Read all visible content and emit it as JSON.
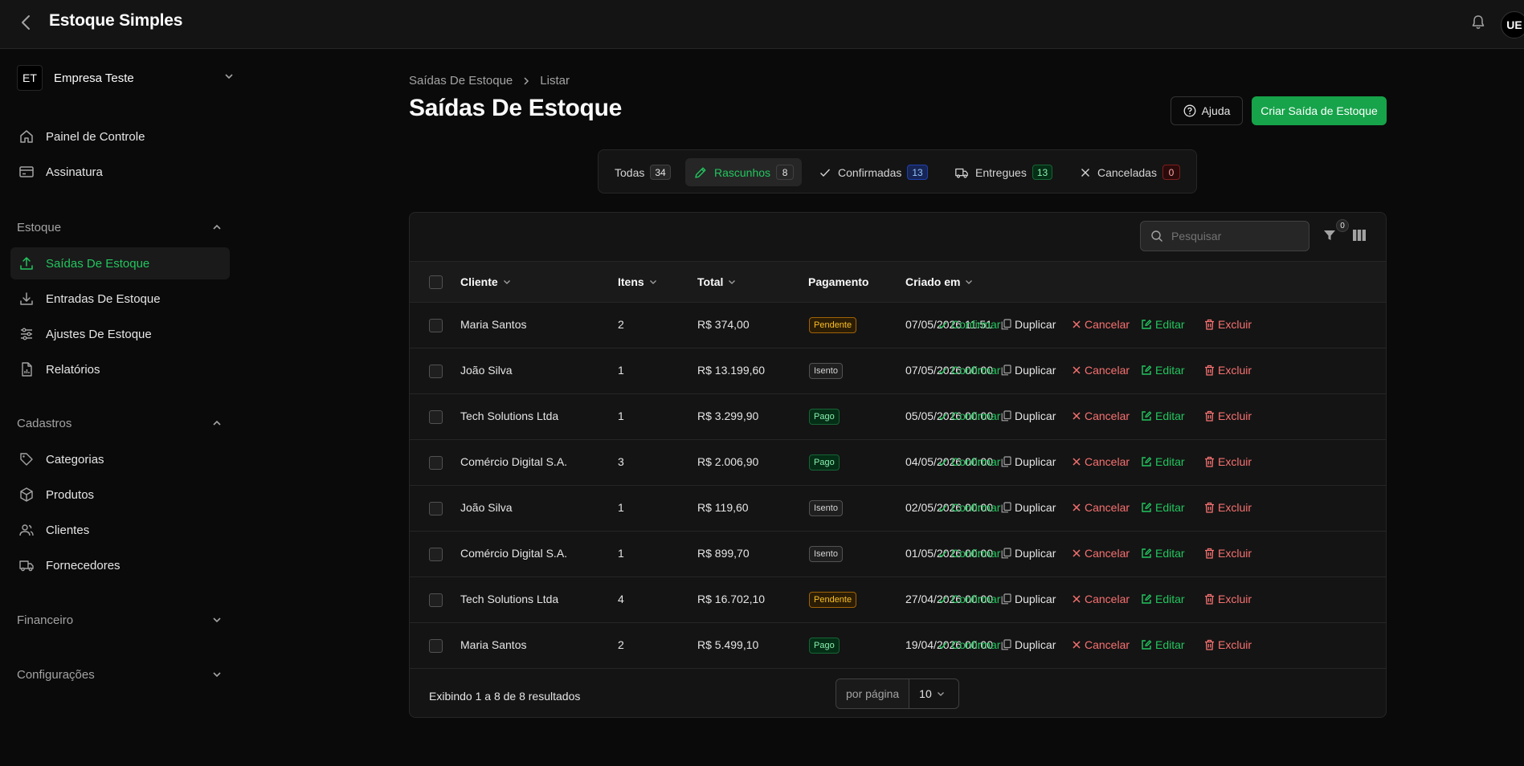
{
  "app": {
    "title": "Estoque Simples",
    "avatar": "UE"
  },
  "sidebar": {
    "company": {
      "initials": "ET",
      "name": "Empresa Teste"
    },
    "top_items": [
      {
        "label": "Painel de Controle",
        "icon": "home-icon"
      },
      {
        "label": "Assinatura",
        "icon": "credit-card-icon"
      }
    ],
    "sections": [
      {
        "label": "Estoque",
        "expanded": true,
        "items": [
          {
            "label": "Saídas De Estoque",
            "icon": "upload-icon",
            "active": true
          },
          {
            "label": "Entradas De Estoque",
            "icon": "download-icon"
          },
          {
            "label": "Ajustes De Estoque",
            "icon": "sliders-icon"
          },
          {
            "label": "Relatórios",
            "icon": "report-icon"
          }
        ]
      },
      {
        "label": "Cadastros",
        "expanded": true,
        "items": [
          {
            "label": "Categorias",
            "icon": "tag-icon"
          },
          {
            "label": "Produtos",
            "icon": "box-icon"
          },
          {
            "label": "Clientes",
            "icon": "users-icon"
          },
          {
            "label": "Fornecedores",
            "icon": "truck-icon"
          }
        ]
      },
      {
        "label": "Financeiro",
        "expanded": false,
        "items": []
      },
      {
        "label": "Configurações",
        "expanded": false,
        "items": []
      }
    ]
  },
  "breadcrumb": [
    "Saídas De Estoque",
    "Listar"
  ],
  "page": {
    "title": "Saídas De Estoque",
    "help_label": "Ajuda",
    "create_label": "Criar Saída de Estoque"
  },
  "tabs": [
    {
      "label": "Todas",
      "count": "34",
      "badge_style": "neutral",
      "active": false
    },
    {
      "label": "Rascunhos",
      "count": "8",
      "badge_style": "neutral",
      "active": true
    },
    {
      "label": "Confirmadas",
      "count": "13",
      "badge_style": "blue",
      "active": false
    },
    {
      "label": "Entregues",
      "count": "13",
      "badge_style": "green",
      "active": false
    },
    {
      "label": "Canceladas",
      "count": "0",
      "badge_style": "red",
      "active": false
    }
  ],
  "table": {
    "search_placeholder": "Pesquisar",
    "filter_count": "0",
    "columns": [
      "Cliente",
      "Itens",
      "Total",
      "Pagamento",
      "Criado em"
    ],
    "actions": [
      "Confirmar",
      "Duplicar",
      "Cancelar",
      "Editar",
      "Excluir"
    ],
    "rows": [
      {
        "cliente": "Maria Santos",
        "itens": "2",
        "total": "R$ 374,00",
        "pagamento": "Pendente",
        "criado": "07/05/2026 11:51"
      },
      {
        "cliente": "João Silva",
        "itens": "1",
        "total": "R$ 13.199,60",
        "pagamento": "Isento",
        "criado": "07/05/2026 00:00"
      },
      {
        "cliente": "Tech Solutions Ltda",
        "itens": "1",
        "total": "R$ 3.299,90",
        "pagamento": "Pago",
        "criado": "05/05/2026 00:00"
      },
      {
        "cliente": "Comércio Digital S.A.",
        "itens": "3",
        "total": "R$ 2.006,90",
        "pagamento": "Pago",
        "criado": "04/05/2026 00:00"
      },
      {
        "cliente": "João Silva",
        "itens": "1",
        "total": "R$ 119,60",
        "pagamento": "Isento",
        "criado": "02/05/2026 00:00"
      },
      {
        "cliente": "Comércio Digital S.A.",
        "itens": "1",
        "total": "R$ 899,70",
        "pagamento": "Isento",
        "criado": "01/05/2026 00:00"
      },
      {
        "cliente": "Tech Solutions Ltda",
        "itens": "4",
        "total": "R$ 16.702,10",
        "pagamento": "Pendente",
        "criado": "27/04/2026 00:00"
      },
      {
        "cliente": "Maria Santos",
        "itens": "2",
        "total": "R$ 5.499,10",
        "pagamento": "Pago",
        "criado": "19/04/2026 00:00"
      }
    ],
    "footer_text": "Exibindo 1 a 8 de 8 resultados",
    "per_page_label": "por página",
    "per_page_value": "10"
  },
  "colors": {
    "accent": "#22c55e",
    "primary_button": "#16a34a",
    "danger": "#f87171",
    "warning": "#fbbf24"
  }
}
